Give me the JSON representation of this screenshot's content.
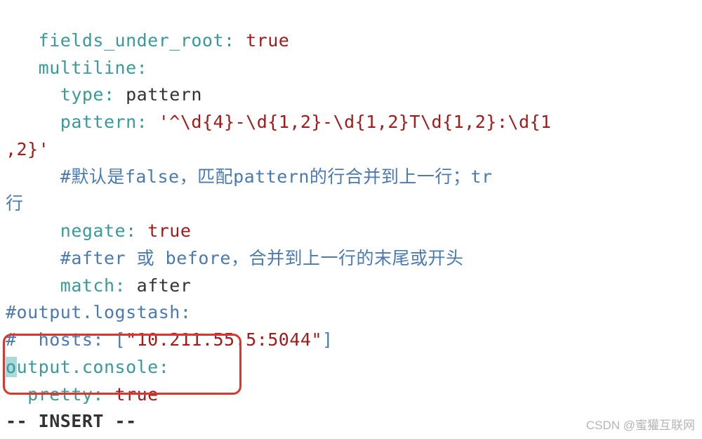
{
  "lines": {
    "l1_key": "fields_under_root:",
    "l1_val": "true",
    "l2_key": "multiline:",
    "l3_key": "type:",
    "l3_val": "pattern",
    "l4_key": "pattern:",
    "l4_val": "'^\\d{4}-\\d{1,2}-\\d{1,2}T\\d{1,2}:\\d{1",
    "l5_val": ",2}'",
    "l6_comment": "#默认是false，匹配pattern的行合并到上一行；tr",
    "l7_text": "行",
    "l8_key": "negate:",
    "l8_val": "true",
    "l9_comment": "#after 或 before，合并到上一行的末尾或开头",
    "l10_key": "match:",
    "l10_val": "after",
    "l11_comment": "#output.logstash:",
    "l12_comment_a": "#  hosts: [",
    "l12_comment_b": "\"10.211.55.5:5044\"",
    "l12_comment_c": "]",
    "l13_cursor": "o",
    "l13_key": "utput.console:",
    "l14_key": "pretty:",
    "l14_val": "true",
    "insert_mode": "-- INSERT --"
  },
  "watermark": "CSDN @蜜獾互联网"
}
